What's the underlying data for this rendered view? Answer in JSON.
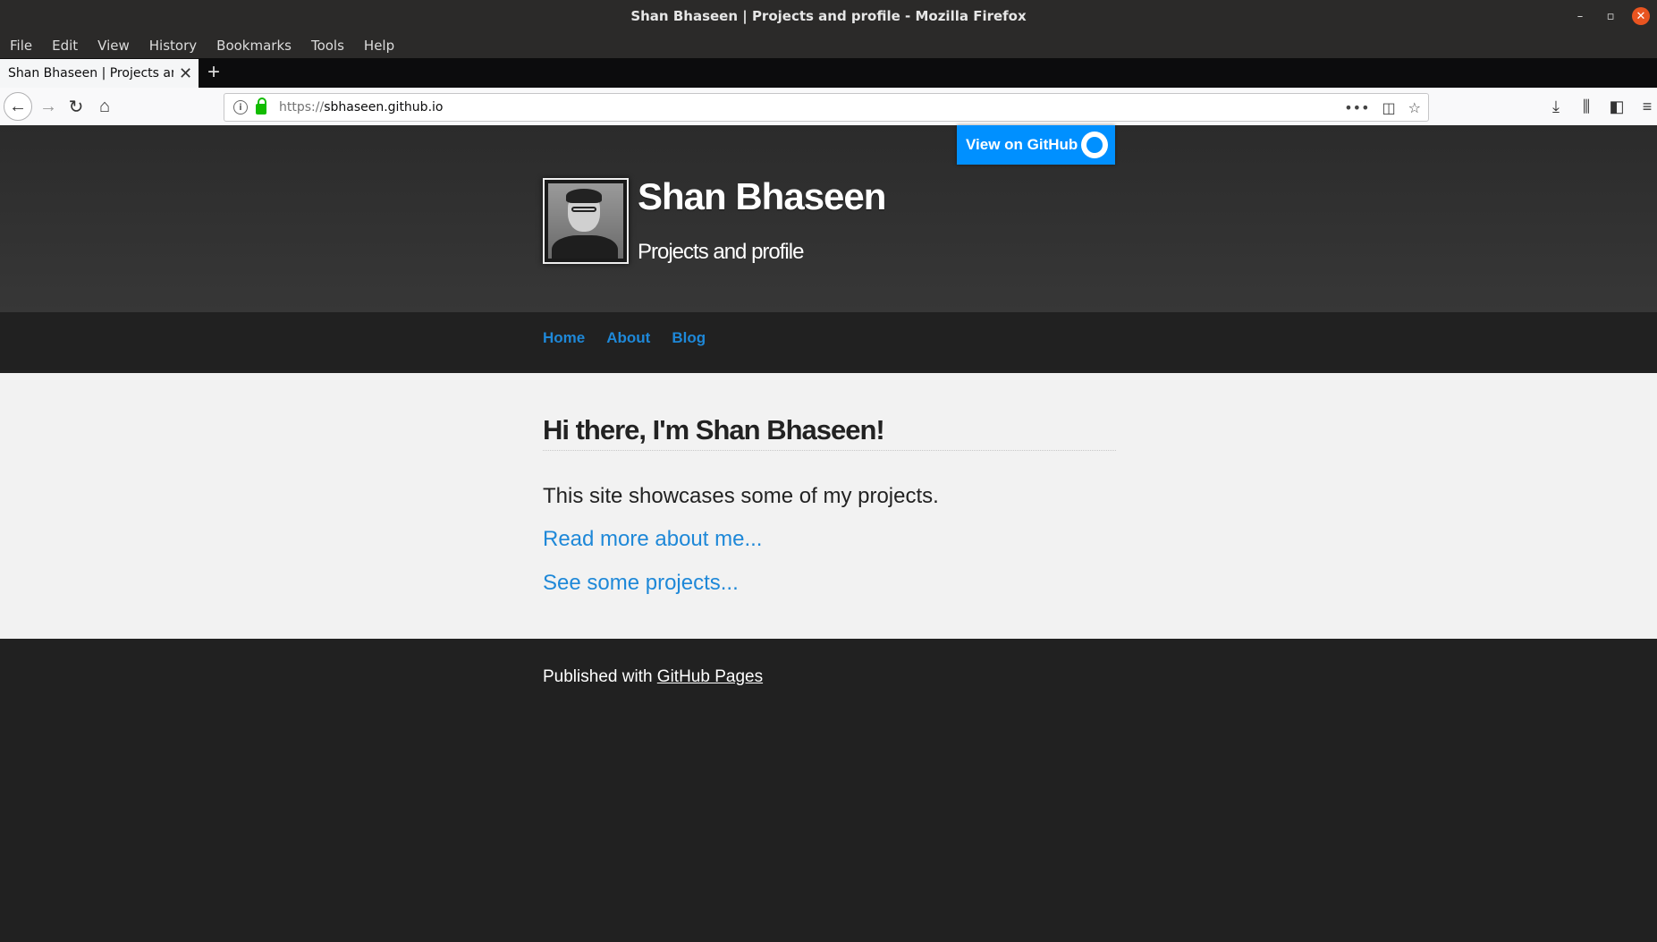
{
  "window": {
    "title": "Shan Bhaseen | Projects and profile - Mozilla Firefox"
  },
  "menubar": {
    "items": [
      "File",
      "Edit",
      "View",
      "History",
      "Bookmarks",
      "Tools",
      "Help"
    ]
  },
  "tab": {
    "title": "Shan Bhaseen | Projects and"
  },
  "urlbar": {
    "protocol": "https://",
    "host": "sbhaseen.github.io"
  },
  "page": {
    "github_button": "View on GitHub",
    "title": "Shan Bhaseen",
    "subtitle": "Projects and profile",
    "nav": [
      "Home",
      "About",
      "Blog"
    ],
    "heading": "Hi there, I'm Shan Bhaseen!",
    "intro": "This site showcases some of my projects.",
    "link_about": "Read more about me...",
    "link_projects": "See some projects...",
    "footer_prefix": "Published with ",
    "footer_link": "GitHub Pages"
  },
  "colors": {
    "accent": "#1e88d8",
    "github_button": "#0090ff",
    "close_button": "#e95420"
  }
}
